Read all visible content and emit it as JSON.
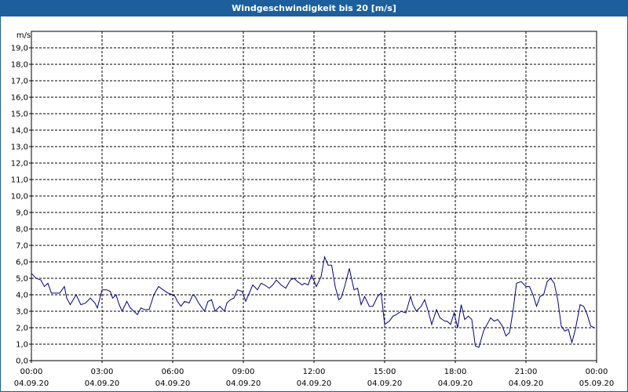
{
  "window": {
    "title": "Windgeschwindigkeit bis 20 [m/s]"
  },
  "chart_data": {
    "type": "line",
    "title": "Windgeschwindigkeit bis 20 [m/s]",
    "ylabel": "m/s",
    "xlabel": "",
    "ylim": [
      0,
      20
    ],
    "xlim": [
      0,
      24
    ],
    "y_ticks": [
      "0,0",
      "1,0",
      "2,0",
      "3,0",
      "4,0",
      "5,0",
      "6,0",
      "7,0",
      "8,0",
      "9,0",
      "10,0",
      "11,0",
      "12,0",
      "13,0",
      "14,0",
      "15,0",
      "16,0",
      "17,0",
      "18,0",
      "19,0"
    ],
    "x_ticks": [
      {
        "time": "00:00",
        "date": "04.09.20"
      },
      {
        "time": "03:00",
        "date": "04.09.20"
      },
      {
        "time": "06:00",
        "date": "04.09.20"
      },
      {
        "time": "09:00",
        "date": "04.09.20"
      },
      {
        "time": "12:00",
        "date": "04.09.20"
      },
      {
        "time": "15:00",
        "date": "04.09.20"
      },
      {
        "time": "18:00",
        "date": "04.09.20"
      },
      {
        "time": "21:00",
        "date": "04.09.20"
      },
      {
        "time": "00:00",
        "date": "05.09.20"
      }
    ],
    "grid": true,
    "line_color": "#00008b",
    "series": [
      {
        "x": [
          0.0,
          0.2,
          0.4,
          0.55,
          0.7,
          0.85,
          1.0,
          1.2,
          1.4,
          1.5,
          1.65,
          1.9,
          2.1,
          2.3,
          2.5,
          2.7,
          2.8,
          3.0,
          3.2,
          3.35,
          3.45,
          3.6,
          3.7,
          3.85,
          4.05,
          4.2,
          4.35,
          4.5,
          4.65,
          4.8,
          5.0,
          5.2,
          5.4,
          5.6,
          5.8,
          6.0,
          6.1,
          6.2,
          6.35,
          6.5,
          6.7,
          6.85,
          6.95,
          7.1,
          7.2,
          7.35,
          7.5,
          7.65,
          7.8,
          8.0,
          8.2,
          8.3,
          8.45,
          8.6,
          8.75,
          8.95,
          9.1,
          9.25,
          9.4,
          9.6,
          9.75,
          9.9,
          10.1,
          10.25,
          10.4,
          10.6,
          10.8,
          11.0,
          11.15,
          11.3,
          11.5,
          11.6,
          11.75,
          11.9,
          12.1,
          12.2,
          12.3,
          12.45,
          12.6,
          12.75,
          12.9,
          13.05,
          13.15,
          13.3,
          13.5,
          13.7,
          13.85,
          14.0,
          14.15,
          14.35,
          14.5,
          14.7,
          14.85,
          15.0,
          15.2,
          15.35,
          15.5,
          15.7,
          15.9,
          16.1,
          16.2,
          16.35,
          16.55,
          16.7,
          16.85,
          17.0,
          17.2,
          17.35,
          17.45,
          17.55,
          17.65,
          17.8,
          17.95,
          18.1,
          18.25,
          18.4,
          18.55,
          18.7,
          18.85,
          19.0,
          19.2,
          19.35,
          19.5,
          19.65,
          19.8,
          20.0,
          20.15,
          20.3,
          20.45,
          20.6,
          20.8,
          21.0,
          21.15,
          21.3,
          21.45,
          21.6,
          21.75,
          21.9,
          22.05,
          22.2,
          22.35,
          22.5,
          22.65,
          22.8,
          22.95,
          23.1,
          23.3,
          23.45,
          23.6,
          23.75,
          23.9
        ],
        "y": [
          5.3,
          5.0,
          4.9,
          4.5,
          4.7,
          4.1,
          4.1,
          4.1,
          4.5,
          3.8,
          3.4,
          4.0,
          3.4,
          3.5,
          3.8,
          3.5,
          3.2,
          4.3,
          4.3,
          4.2,
          3.8,
          4.0,
          3.5,
          3.0,
          3.6,
          3.2,
          3.0,
          2.8,
          3.2,
          3.1,
          3.1,
          4.0,
          4.5,
          4.3,
          4.1,
          4.0,
          3.9,
          3.6,
          3.3,
          3.6,
          3.5,
          4.0,
          3.9,
          3.5,
          3.3,
          3.0,
          3.6,
          3.7,
          3.0,
          3.3,
          3.0,
          3.5,
          3.7,
          3.8,
          4.3,
          4.2,
          3.6,
          4.1,
          4.6,
          4.3,
          4.7,
          4.6,
          4.4,
          4.6,
          4.9,
          4.6,
          4.4,
          4.9,
          5.0,
          4.8,
          4.6,
          4.7,
          4.6,
          5.2,
          4.5,
          4.8,
          5.1,
          6.3,
          5.8,
          5.8,
          4.5,
          3.7,
          3.8,
          4.5,
          5.6,
          4.3,
          4.4,
          3.4,
          3.9,
          3.3,
          3.3,
          3.9,
          4.1,
          2.2,
          2.4,
          2.7,
          2.8,
          3.0,
          2.9,
          3.9,
          3.4,
          3.0,
          3.3,
          3.7,
          3.0,
          2.2,
          3.1,
          2.6,
          2.5,
          2.4,
          2.4,
          2.2,
          2.9,
          2.0,
          3.4,
          2.5,
          2.7,
          2.5,
          0.9,
          0.8,
          1.8,
          2.2,
          2.6,
          2.4,
          2.5,
          2.1,
          1.5,
          1.7,
          3.0,
          4.7,
          4.8,
          4.5,
          4.5,
          4.0,
          3.3,
          3.9,
          4.0,
          4.8,
          5.0,
          4.7,
          3.7,
          2.1,
          1.8,
          1.9,
          1.1,
          1.9,
          3.4,
          3.3,
          2.8,
          2.1,
          2.0
        ]
      }
    ]
  }
}
